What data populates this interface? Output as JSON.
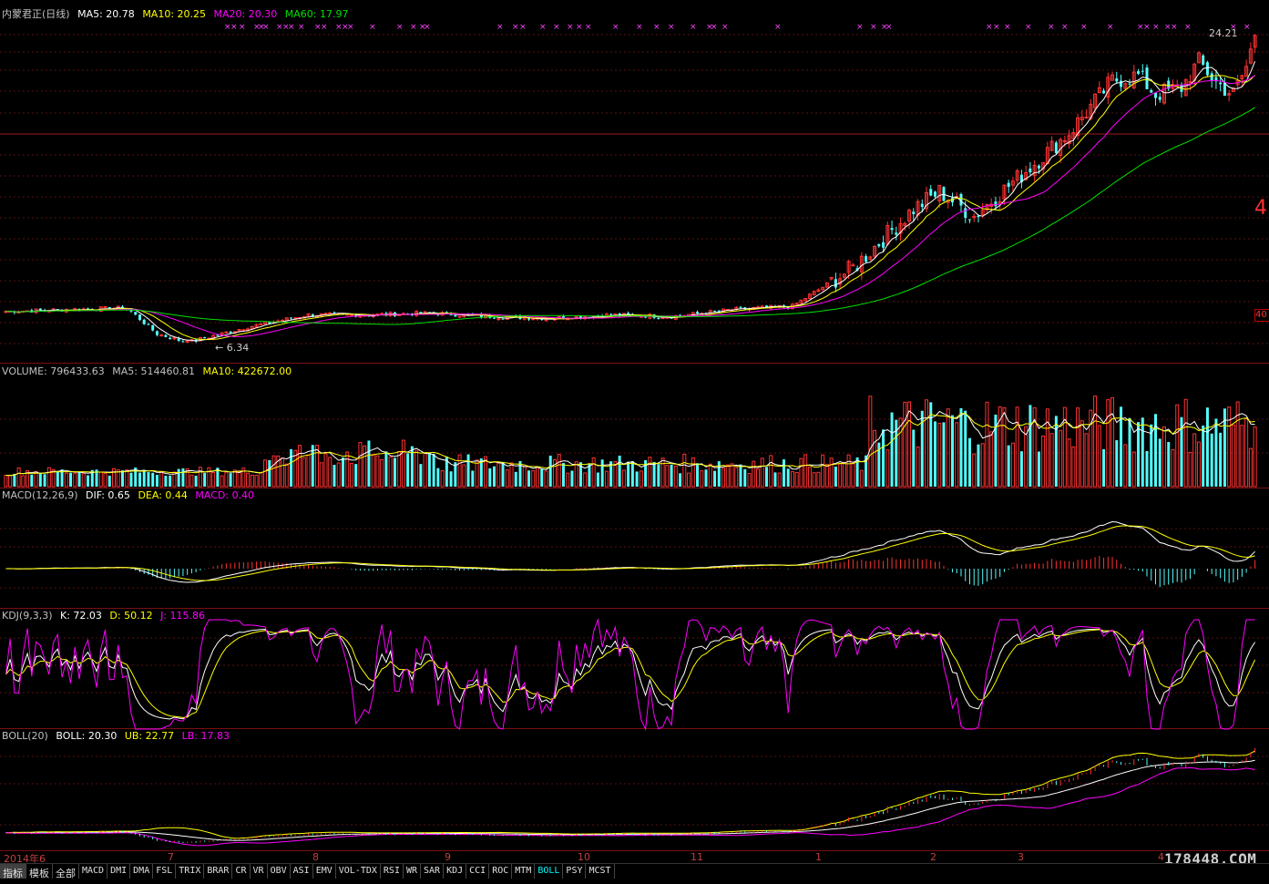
{
  "colors": {
    "up": "#ff3232",
    "down": "#54fcfc",
    "ma5": "#ffffff",
    "ma10": "#ffff00",
    "ma20": "#ff00ff",
    "ma60": "#00e000",
    "border": "#7a1010",
    "grid": "#5a0f0f"
  },
  "price_panel": {
    "title": "内蒙君正(日线)",
    "ma5_label": "MA5: 20.78",
    "ma10_label": "MA10: 20.25",
    "ma20_label": "MA20: 20.30",
    "ma60_label": "MA60: 17.97",
    "high_tag": "24.21",
    "low_tag": "← 6.34",
    "right_tag_mid": "4",
    "right_tag_low": "40"
  },
  "volume_panel": {
    "volume_label": "VOLUME: 796433.63",
    "ma5_label": "MA5: 514460.81",
    "ma10_label": "MA10: 422672.00"
  },
  "macd_panel": {
    "title": "MACD(12,26,9)",
    "dif_label": "DIF: 0.65",
    "dea_label": "DEA: 0.44",
    "macd_label": "MACD: 0.40"
  },
  "kdj_panel": {
    "title": "KDJ(9,3,3)",
    "k_label": "K: 72.03",
    "d_label": "D: 50.12",
    "j_label": "J: 115.86"
  },
  "boll_panel": {
    "title": "BOLL(20)",
    "boll_label": "BOLL: 20.30",
    "ub_label": "UB: 22.77",
    "lb_label": "LB: 17.83"
  },
  "x_axis": {
    "labels": [
      "2014年6",
      "7",
      "8",
      "9",
      "10",
      "11",
      "1",
      "2",
      "3",
      "4"
    ]
  },
  "tabs": [
    "指标",
    "模板",
    "全部",
    "MACD",
    "DMI",
    "DMA",
    "FSL",
    "TRIX",
    "BRAR",
    "CR",
    "VR",
    "OBV",
    "ASI",
    "EMV",
    "VOL-TDX",
    "RSI",
    "WR",
    "SAR",
    "KDJ",
    "CCI",
    "ROC",
    "MTM",
    "BOLL",
    "PSY",
    "MCST"
  ],
  "active_tab": "BOLL",
  "watermark": "178448.COM",
  "chart_data": {
    "type": "candlestick",
    "title": "内蒙君正(日线)",
    "period": "2014-06 to 2015-04",
    "months": [
      "2014年6",
      "7",
      "8",
      "9",
      "10",
      "11",
      "1",
      "2",
      "3",
      "4"
    ],
    "price_anchors": {
      "low": 6.34,
      "high": 24.21
    },
    "close_path_x": [
      0,
      14,
      28,
      35,
      42,
      56,
      70,
      84,
      98,
      112,
      126,
      140,
      154,
      168,
      182,
      196,
      210,
      216,
      224
    ],
    "close_path_y": [
      8.3,
      8.4,
      8.5,
      7.0,
      6.5,
      7.4,
      8.1,
      8.1,
      8.2,
      8.0,
      7.9,
      8.1,
      8.0,
      8.4,
      8.6,
      10.8,
      14.2,
      15.2,
      13.8
    ],
    "close_path_y2": [
      16.4,
      18.6,
      21.6,
      21.9,
      20.8,
      21.2,
      22.7,
      21.5,
      20.8,
      22.4,
      24.21
    ],
    "indicators": {
      "MA5": 20.78,
      "MA10": 20.25,
      "MA20": 20.3,
      "MA60": 17.97,
      "VOLUME": 796433.63,
      "VOL_MA5": 514460.81,
      "VOL_MA10": 422672.0,
      "DIF": 0.65,
      "DEA": 0.44,
      "MACD": 0.4,
      "K": 72.03,
      "D": 50.12,
      "J": 115.86,
      "BOLL": 20.3,
      "UB": 22.77,
      "LB": 17.83
    }
  }
}
